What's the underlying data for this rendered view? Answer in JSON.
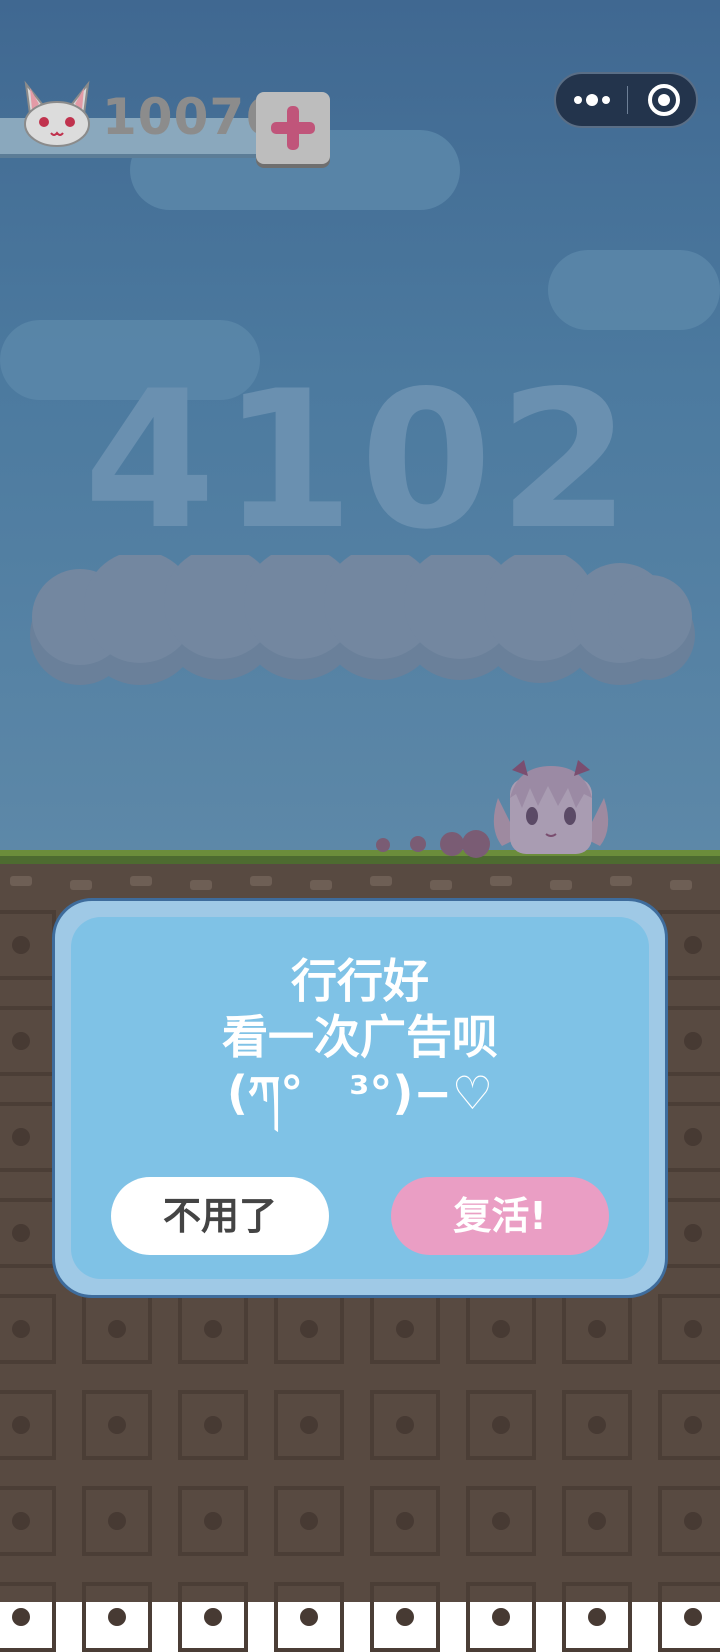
{
  "hud": {
    "coin_count": "10076",
    "add_button_symbol": "+",
    "coin_icon": "cat-face-icon"
  },
  "menu_capsule": {
    "more_icon": "more-dots-icon",
    "close_icon": "target-circle-icon"
  },
  "game": {
    "score": "4102"
  },
  "dialog": {
    "line1": "行行好",
    "line2": "看一次广告呗",
    "line3": "(ཀ°　³°)−♡",
    "decline_label": "不用了",
    "revive_label": "复活!"
  },
  "colors": {
    "sky": "#4c7a9f",
    "dialog_bg": "#7fc2e6",
    "revive_button": "#ea9ec4",
    "ground": "#584a41"
  }
}
